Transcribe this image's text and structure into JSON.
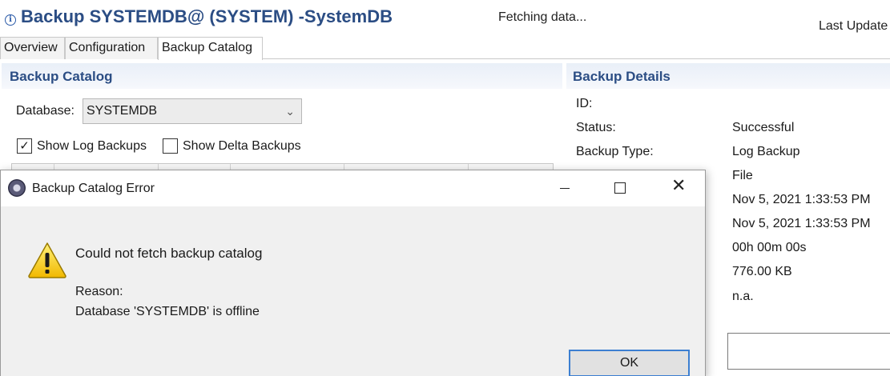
{
  "header": {
    "title": "Backup SYSTEMDB@       (SYSTEM)        -SystemDB",
    "status": "Fetching data...",
    "last_update": "Last Update"
  },
  "tabs": [
    {
      "label": "Overview",
      "active": false
    },
    {
      "label": "Configuration",
      "active": false
    },
    {
      "label": "Backup Catalog",
      "active": true
    }
  ],
  "catalog": {
    "title": "Backup Catalog",
    "database_label": "Database:",
    "database_value": "SYSTEMDB",
    "show_log_backups": {
      "label": "Show Log Backups",
      "checked": true
    },
    "show_delta_backups": {
      "label": "Show Delta Backups",
      "checked": false
    }
  },
  "details": {
    "title": "Backup Details",
    "labels": [
      "ID:",
      "Status:",
      "Backup Type:"
    ],
    "values": [
      "",
      "Successful",
      "Log Backup",
      "File",
      "Nov 5, 2021 1:33:53 PM",
      "Nov 5, 2021 1:33:53 PM",
      "00h 00m 00s",
      "776.00 KB",
      "n.a."
    ]
  },
  "dialog": {
    "title": "Backup Catalog Error",
    "message": "Could not fetch backup catalog",
    "reason_label": "Reason:",
    "reason": "Database 'SYSTEMDB' is offline",
    "ok_label": "OK",
    "icons": {
      "app": "app-icon",
      "warning": "warning-icon"
    }
  },
  "colors": {
    "title_blue": "#2b4d84",
    "header_band": "#e9eff8",
    "focus_blue": "#3c7fd1",
    "warning_yellow": "#f4c400"
  }
}
